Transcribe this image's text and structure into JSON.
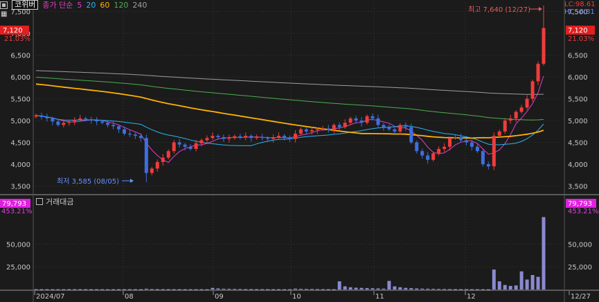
{
  "header": {
    "stock_name": "코위버",
    "ma_title": "종가 단순",
    "ma_periods": [
      "5",
      "20",
      "60",
      "120",
      "240"
    ],
    "ma_colors": [
      "#e040c8",
      "#29b6f6",
      "#ffb300",
      "#4caf50",
      "#9e9e9e"
    ],
    "lc_label": "LC:98.61",
    "hc_label": "HC:-6.81"
  },
  "price_panel": {
    "current_price": "7,120",
    "current_change": "21.03%",
    "high_annotation": "최고 7,640 (12/27)",
    "low_annotation": "최저 3,585 (08/05)",
    "y_ticks": [
      "7,500",
      "7,000",
      "6,500",
      "6,000",
      "5,500",
      "5,000",
      "4,500",
      "4,000",
      "3,500"
    ],
    "right_y_ticks": [
      "7,500",
      "6,500",
      "6,000",
      "5,500",
      "5,000",
      "4,500",
      "4,000",
      "3,500"
    ]
  },
  "volume_panel": {
    "title": "거래대금",
    "current_value": "79,793",
    "current_change": "453.21%",
    "y_ticks": [
      "50,000",
      "25,000"
    ]
  },
  "x_axis": {
    "labels": [
      "2024/07",
      "08",
      "09",
      "10",
      "11",
      "12",
      "12/27"
    ]
  },
  "colors": {
    "up": "#f03c3c",
    "down": "#3d6fe0",
    "volume": "#8a8ad0",
    "current_badge": "#e02020",
    "volume_badge": "#e020e0",
    "background": "#1b1b1b",
    "grid": "#3a3a3a"
  },
  "chart_data": {
    "type": "candlestick",
    "price_range": [
      3350,
      7700
    ],
    "volume_range": [
      0,
      90000
    ],
    "period_start": "2024/07",
    "period_end": "12/27",
    "ohlc_close_approx": [
      5120,
      5080,
      5050,
      4980,
      4900,
      4950,
      4980,
      5020,
      5050,
      5030,
      5000,
      4980,
      4950,
      4900,
      4870,
      4800,
      4700,
      4680,
      4650,
      4600,
      3800,
      3900,
      4050,
      4150,
      4300,
      4500,
      4450,
      4400,
      4350,
      4480,
      4550,
      4600,
      4650,
      4620,
      4580,
      4600,
      4640,
      4620,
      4650,
      4600,
      4620,
      4600,
      4580,
      4620,
      4650,
      4600,
      4580,
      4700,
      4800,
      4750,
      4780,
      4800,
      4820,
      4780,
      4900,
      4850,
      4950,
      5050,
      5000,
      4950,
      5100,
      5050,
      4900,
      4850,
      4800,
      4750,
      4900,
      4850,
      4500,
      4300,
      4200,
      4100,
      4250,
      4350,
      4400,
      4600,
      4620,
      4550,
      4500,
      4400,
      4300,
      4000,
      3950,
      4650,
      4750,
      5000,
      5050,
      5200,
      5300,
      5500,
      5900,
      6300,
      7120
    ],
    "volume_approx": [
      400,
      380,
      360,
      340,
      320,
      330,
      350,
      360,
      350,
      340,
      330,
      320,
      310,
      300,
      310,
      320,
      330,
      340,
      350,
      360,
      900,
      500,
      420,
      400,
      380,
      360,
      350,
      340,
      330,
      320,
      310,
      300,
      1800,
      1200,
      900,
      800,
      700,
      600,
      500,
      450,
      420,
      400,
      380,
      360,
      340,
      320,
      300,
      1000,
      800,
      700,
      600,
      500,
      450,
      400,
      350,
      9000,
      3500,
      2500,
      2000,
      1800,
      1600,
      1400,
      1200,
      1000,
      9500,
      3500,
      2500,
      1800,
      1500,
      1200,
      1000,
      900,
      800,
      700,
      600,
      500,
      450,
      400,
      380,
      360,
      340,
      320,
      300,
      22000,
      9000,
      5000,
      4000,
      4500,
      20000,
      11000,
      16000,
      14000,
      79793
    ]
  }
}
